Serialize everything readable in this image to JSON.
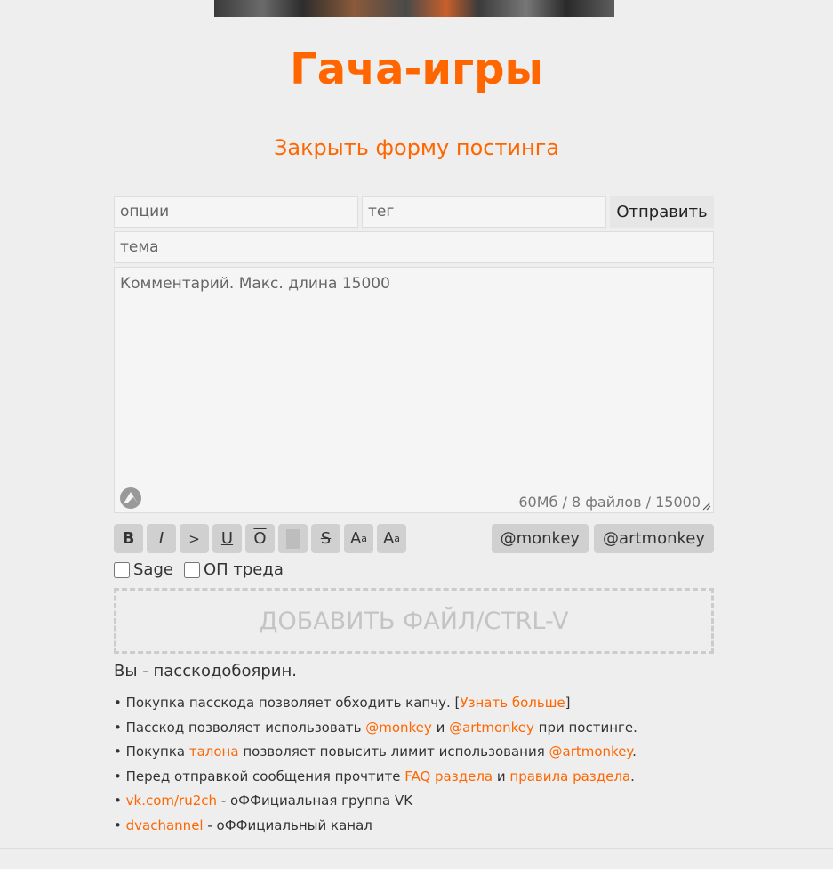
{
  "board": {
    "title": "Гача-игры"
  },
  "close_form": "Закрыть форму постинга",
  "form": {
    "options_placeholder": "опции",
    "tag_placeholder": "тег",
    "submit_label": "Отправить",
    "subject_placeholder": "тема",
    "comment_placeholder": "Комментарий. Макс. длина 15000",
    "counter": "60Мб / 8 файлов / 15000"
  },
  "toolbar": {
    "bold": "B",
    "italic": "I",
    "quote": ">",
    "underline": "U",
    "overline": "O",
    "strike": "S",
    "sup_base": "A",
    "sup_small": "a",
    "sub_base": "A",
    "sub_small": "a",
    "monkey": "@monkey",
    "artmonkey": "@artmonkey"
  },
  "checkboxes": {
    "sage": "Sage",
    "op": "ОП треда"
  },
  "dropzone": "ДОБАВИТЬ ФАЙЛ/CTRL-V",
  "passcode_status": "Вы - пасскодобоярин.",
  "info": {
    "bullet": "•",
    "l1_text": " Покупка пасскода позволяет обходить капчу. [",
    "l1_link": "Узнать больше",
    "l1_end": "]",
    "l2_text": " Пасскод позволяет использовать ",
    "l2_link1": "@monkey",
    "l2_and": " и ",
    "l2_link2": "@artmonkey",
    "l2_end": " при постинге.",
    "l3_text": " Покупка ",
    "l3_link1": "талона",
    "l3_mid": " позволяет повысить лимит использования ",
    "l3_link2": "@artmonkey",
    "l3_end": ".",
    "l4_text": " Перед отправкой сообщения прочтите ",
    "l4_link1": "FAQ раздела",
    "l4_and": " и ",
    "l4_link2": "правила раздела",
    "l4_end": ".",
    "l5_link": "vk.com/ru2ch",
    "l5_text": " - оФФициальная группа VK",
    "l6_link": "dvachannel",
    "l6_text": " - оФФициальный канал"
  },
  "colors": {
    "accent": "#ff6600",
    "background": "#eeeeee",
    "button": "#d0d0d0"
  }
}
